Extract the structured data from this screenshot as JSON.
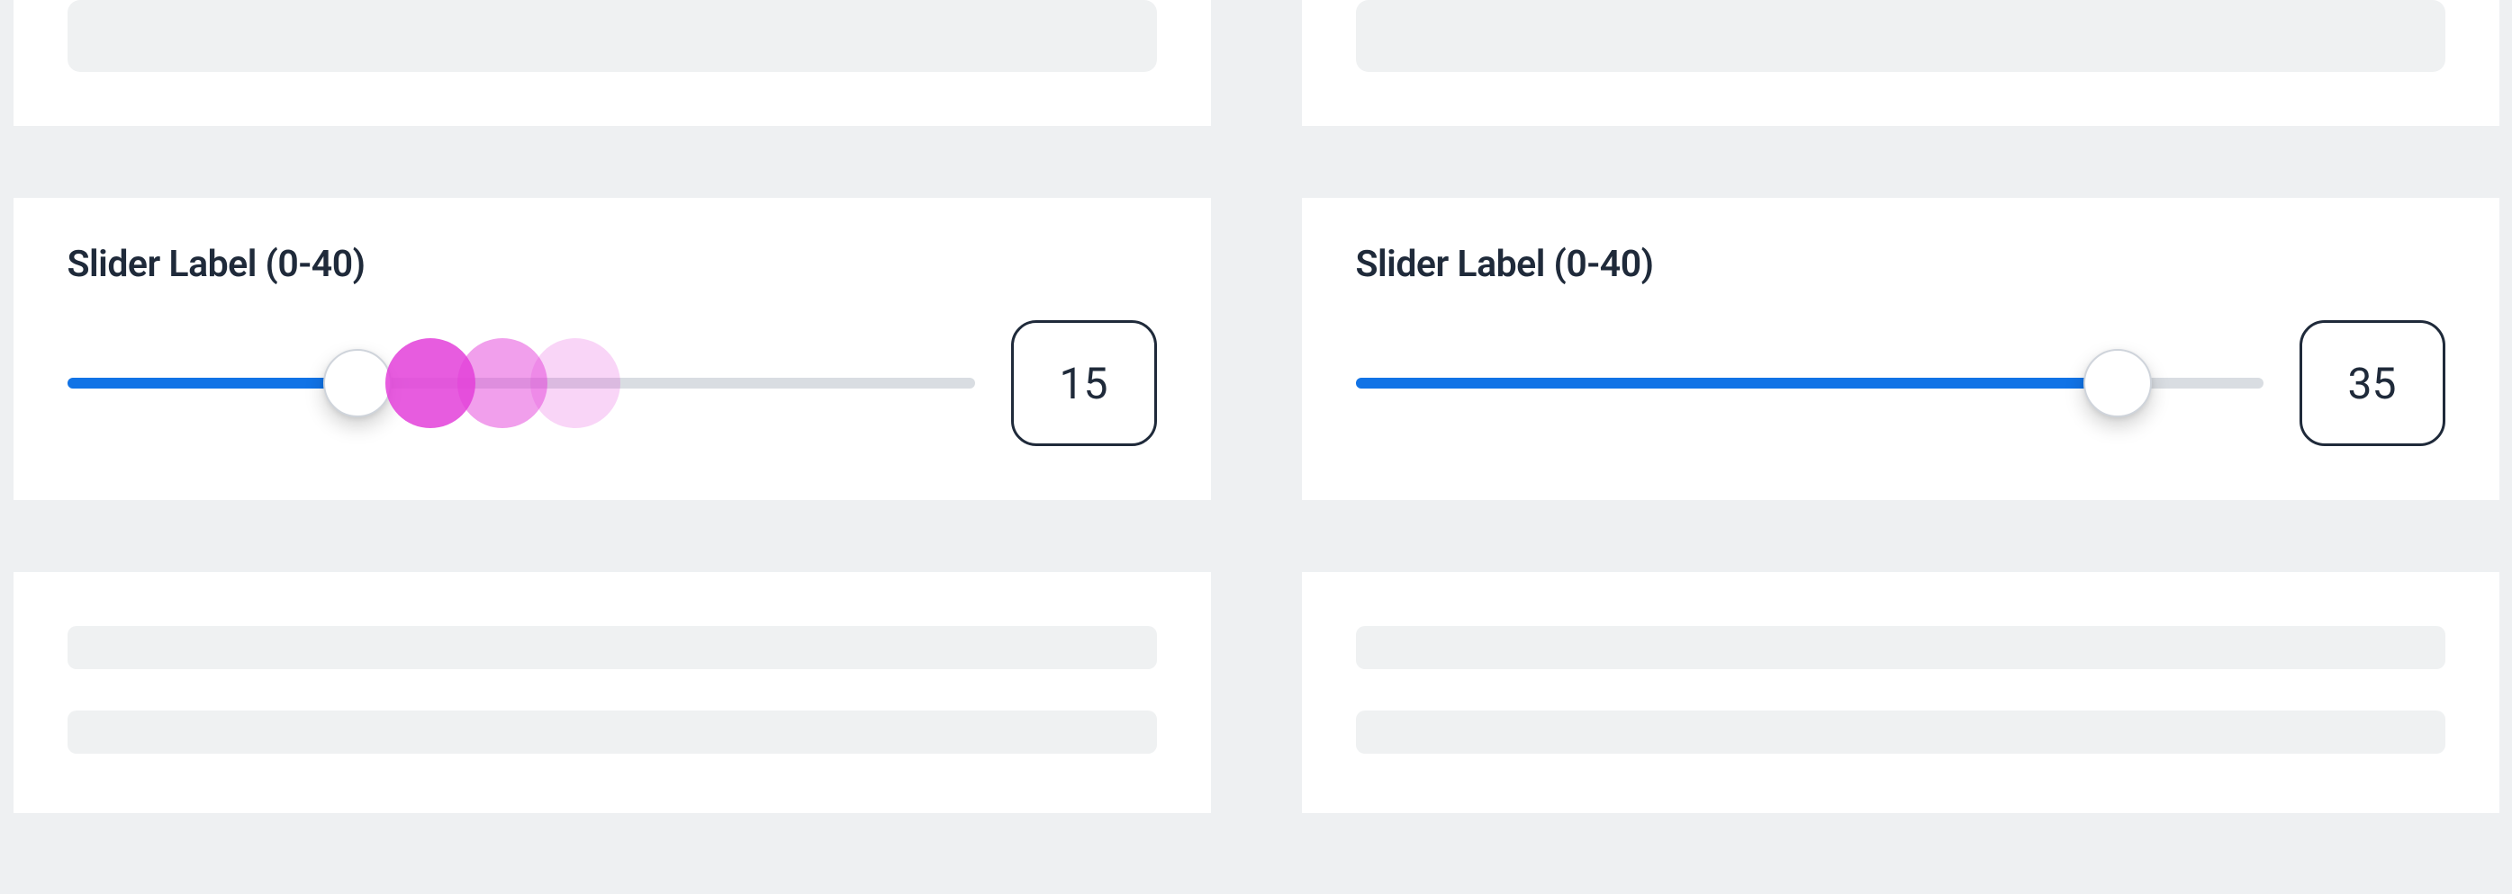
{
  "colors": {
    "background": "#eef0f2",
    "card": "#ffffff",
    "placeholder": "#eff1f2",
    "track": "#d9dde2",
    "fill": "#1173e6",
    "text": "#1f2a3a",
    "touch": "#e33fd9"
  },
  "slider_range": {
    "min": 0,
    "max": 40
  },
  "panels": [
    {
      "id": "left",
      "label": "Slider Label (0-40)",
      "value": 15,
      "value_display": "15",
      "fill_percent": 32,
      "show_touch_trail": true,
      "touch_positions_percent": [
        40,
        48,
        56
      ]
    },
    {
      "id": "right",
      "label": "Slider Label (0-40)",
      "value": 35,
      "value_display": "35",
      "fill_percent": 84,
      "show_touch_trail": false,
      "touch_positions_percent": []
    }
  ]
}
